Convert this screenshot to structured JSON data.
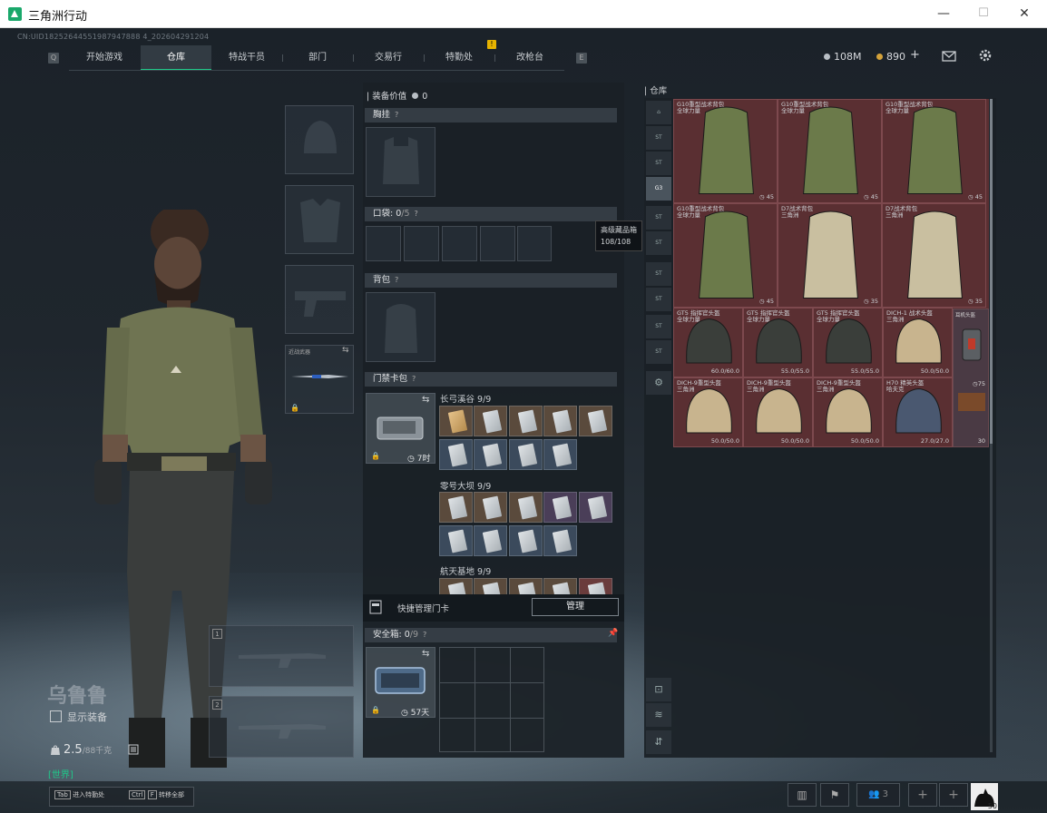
{
  "window": {
    "title": "三角洲行动",
    "min": "—",
    "max": "☐",
    "close": "✕"
  },
  "uid": "CN:UID18252644551987947888 4_202604291204",
  "nav": {
    "tabs": [
      "开始游戏",
      "仓库",
      "特战干员",
      "部门",
      "交易行",
      "特勤处",
      "改枪台"
    ],
    "active": "仓库",
    "left_key": "Q",
    "right_key": "E",
    "warn_badge": "!"
  },
  "currency": {
    "coins": "108M",
    "gold": "890",
    "plus": "+"
  },
  "character": {
    "name": "乌鲁鲁",
    "display_equip_label": "显示装备",
    "weight": "2.5",
    "weight_limit": "/88千克",
    "world_tag": "[世界]"
  },
  "loadout": {
    "melee_label": "近战武器",
    "weapon_slot_1": "1",
    "weapon_slot_2": "2"
  },
  "equipment": {
    "value_label": "装备价值",
    "value": "0",
    "chest_label": "胸挂",
    "pockets_label": "口袋",
    "pockets_count": "0",
    "pockets_cap": "/5",
    "backpack_label": "背包",
    "keycard_label": "门禁卡包",
    "keycard_timer": "7时",
    "quick_manage_label": "快捷管理门卡",
    "manage_btn": "管理",
    "safe_label": "安全箱",
    "safe_count": "0",
    "safe_cap": "/9",
    "safe_timer": "57天",
    "help": "?"
  },
  "keycard_maps": [
    {
      "name": "长弓溪谷",
      "count": "9/9"
    },
    {
      "name": "零号大坝",
      "count": "9/9"
    },
    {
      "name": "航天基地",
      "count": "9/9"
    }
  ],
  "tooltip": {
    "title": "高级藏品箱",
    "value": "108/108"
  },
  "storage": {
    "label": "仓库",
    "items": [
      {
        "name": "G10重型战术背包",
        "sub": "全球力量",
        "value": "45"
      },
      {
        "name": "G10重型战术背包",
        "sub": "全球力量",
        "value": "45"
      },
      {
        "name": "G10重型战术背包",
        "sub": "全球力量",
        "value": "45"
      },
      {
        "name": "G10重型战术背包",
        "sub": "全球力量",
        "value": "45"
      },
      {
        "name": "D7战术背包",
        "sub": "三角洲",
        "value": "35"
      },
      {
        "name": "D7战术背包",
        "sub": "三角洲",
        "value": "35"
      },
      {
        "name": "GT5 指挥官头盔",
        "sub": "全球力量",
        "value": "60.0/60.0"
      },
      {
        "name": "GT5 指挥官头盔",
        "sub": "全球力量",
        "value": "55.0/55.0"
      },
      {
        "name": "GT5 指挥官头盔",
        "sub": "全球力量",
        "value": "55.0/55.0"
      },
      {
        "name": "DICH-1 战术头盔",
        "sub": "三角洲",
        "value": "50.0/50.0"
      },
      {
        "name": "DICH-9重型头盔",
        "sub": "三角洲",
        "value": "50.0/50.0"
      },
      {
        "name": "DICH-9重型头盔",
        "sub": "三角洲",
        "value": "50.0/50.0"
      },
      {
        "name": "DICH-9重型头盔",
        "sub": "三角洲",
        "value": "50.0/50.0"
      },
      {
        "name": "H70 精英头盔",
        "sub": "哈夫克",
        "value": "27.0/27.0"
      }
    ],
    "side_item": {
      "name": "耳机头盔",
      "value": "75",
      "count": "30"
    }
  },
  "bottom": {
    "tab_key": "Tab",
    "tab_label": "进入特勤处",
    "ctrl_key": "Ctrl",
    "f_key": "F",
    "ctrl_label": "转移全部",
    "friends": "3",
    "avatar_level": "50"
  }
}
